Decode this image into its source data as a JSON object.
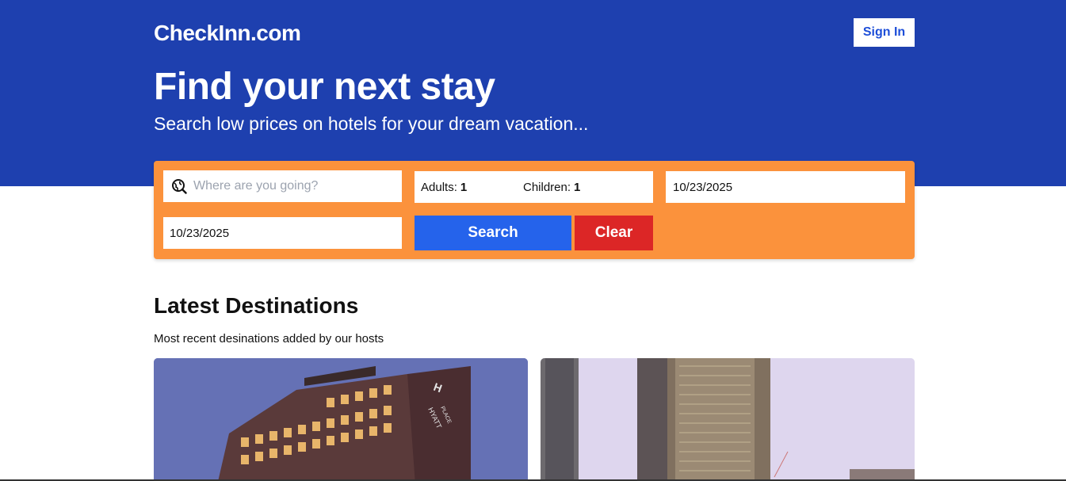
{
  "header": {
    "logo": "CheckInn.com",
    "sign_in_label": "Sign In",
    "headline": "Find your next stay",
    "subheadline": "Search low prices on hotels for your dream vacation..."
  },
  "search": {
    "destination_placeholder": "Where are you going?",
    "adults_label": "Adults:",
    "adults_value": "1",
    "children_label": "Children:",
    "children_value": "1",
    "check_in": "10/23/2025",
    "check_out": "10/23/2025",
    "search_label": "Search",
    "clear_label": "Clear"
  },
  "destinations": {
    "title": "Latest Destinations",
    "subtitle": "Most recent desinations added by our hosts",
    "card1_sign": "HYATT PLACE"
  },
  "colors": {
    "hero": "#1e40af",
    "panel": "#fb923c",
    "search_button": "#2563eb",
    "clear_button": "#dc2626"
  }
}
